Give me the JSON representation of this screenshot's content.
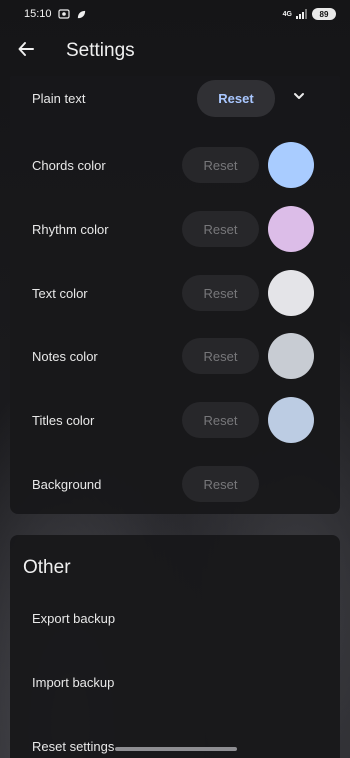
{
  "status_bar": {
    "time": "15:10",
    "network": "4G",
    "battery": "89"
  },
  "header": {
    "title": "Settings"
  },
  "plain_text": {
    "label": "Plain text",
    "reset_label": "Reset"
  },
  "color_rows": [
    {
      "label": "Chords color",
      "reset_label": "Reset",
      "swatch_color": "#a9ccff"
    },
    {
      "label": "Rhythm color",
      "reset_label": "Reset",
      "swatch_color": "#dcbde8"
    },
    {
      "label": "Text color",
      "reset_label": "Reset",
      "swatch_color": "#e4e4e8"
    },
    {
      "label": "Notes color",
      "reset_label": "Reset",
      "swatch_color": "#c8ccd3"
    },
    {
      "label": "Titles color",
      "reset_label": "Reset",
      "swatch_color": "#bccce3"
    },
    {
      "label": "Background",
      "reset_label": "Reset",
      "swatch_color": null
    }
  ],
  "other": {
    "title": "Other",
    "items": [
      "Export backup",
      "Import backup",
      "Reset settings"
    ]
  },
  "colors": {
    "accent": "#a9c7ff",
    "card_bg": "#18181a",
    "button_bg": "#27272a"
  }
}
